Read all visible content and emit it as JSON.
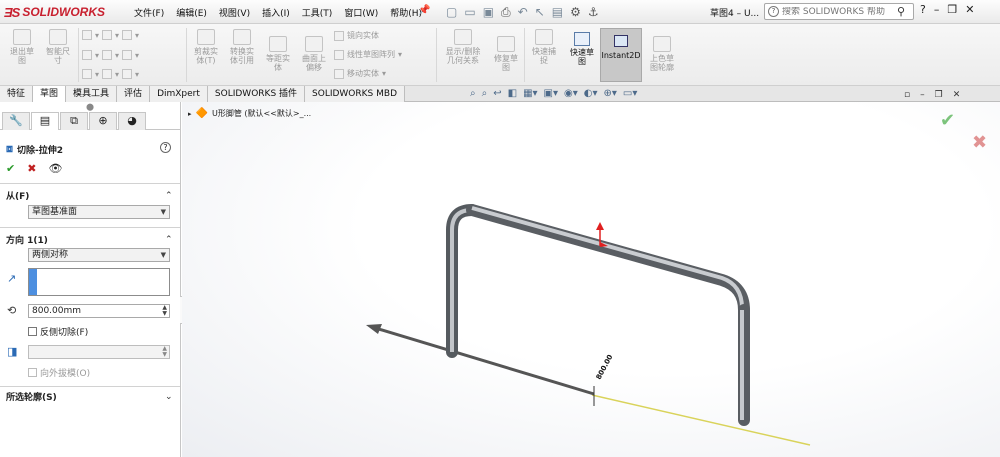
{
  "app": {
    "logo_text": "SOLIDWORKS"
  },
  "menu": [
    "文件(F)",
    "编辑(E)",
    "视图(V)",
    "插入(I)",
    "工具(T)",
    "窗口(W)",
    "帮助(H)"
  ],
  "window": {
    "doc_title": "草图4 – U..."
  },
  "help_search": {
    "placeholder": "搜索 SOLIDWORKS 帮助"
  },
  "ribbon": {
    "exit_sketch": "退出草\n图",
    "smart_dim": "智能尺\n寸",
    "trim": "剪裁实\n体(T)",
    "convert": "转换实\n体引用",
    "offset": "等距实\n体",
    "surface_offset": "曲面上\n偏移",
    "mirror": "镜向实体",
    "linear_pattern": "线性草图阵列",
    "move": "移动实体",
    "display_delete": "显示/删除\n几何关系",
    "repair": "修复草\n图",
    "quick_snaps": "快速捕\n捉",
    "quick_sketch": "快速草\n图",
    "instant2d": "Instant2D",
    "shaded_contours": "上色草\n图轮廓"
  },
  "tabs": [
    "特征",
    "草图",
    "模具工具",
    "评估",
    "DimXpert",
    "SOLIDWORKS 插件",
    "SOLIDWORKS MBD"
  ],
  "property_manager": {
    "feature_title": "切除-拉伸2",
    "from": {
      "label": "从(F)",
      "value": "草图基准面"
    },
    "direction1": {
      "label": "方向 1(1)",
      "end_condition": "两侧对称",
      "depth": "800.00mm",
      "flip_label": "反侧切除(F)",
      "draft_label": "向外拔模(O)"
    },
    "selected_contours": {
      "label": "所选轮廓(S)"
    }
  },
  "tree": {
    "part_name": "U形脚管  (默认<<默认>_..."
  },
  "viewport": {
    "dimension_label": "800.00"
  }
}
